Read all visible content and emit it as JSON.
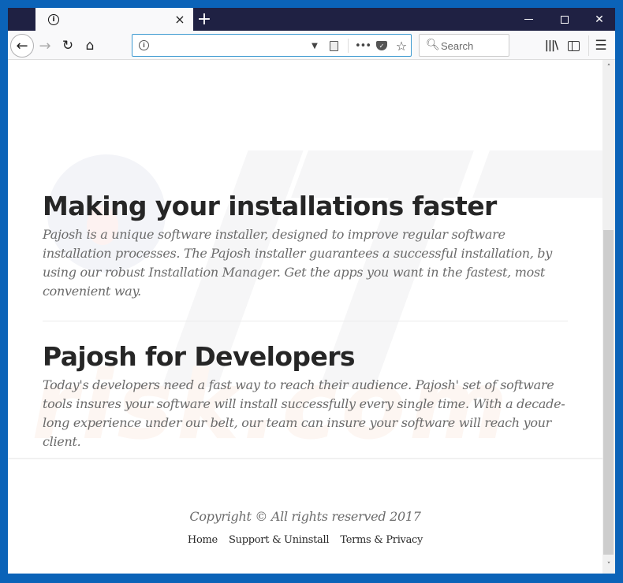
{
  "browser": {
    "tab": {
      "title": "",
      "close_glyph": "×"
    },
    "new_tab_glyph": "+",
    "window_controls": {
      "close_glyph": "✕"
    },
    "nav": {
      "back_glyph": "←",
      "forward_glyph": "→",
      "reload_glyph": "↻",
      "home_glyph": "⌂"
    },
    "urlbar": {
      "value": "",
      "placeholder": ""
    },
    "search": {
      "placeholder": "Search",
      "icon_glyph": "⚲"
    },
    "toolbar": {
      "more_glyph": "•••",
      "star_glyph": "☆",
      "library_glyph": "|||\\",
      "menu_glyph": "☰"
    },
    "scrollbar": {
      "up_glyph": "˄",
      "down_glyph": "˅",
      "scroll_fraction": 0.65
    }
  },
  "page": {
    "sections": [
      {
        "heading": "Making your installations faster",
        "body": "Pajosh is a unique software installer, designed to improve regular software installation processes. The Pajosh installer guarantees a successful installation, by using our robust Installation Manager. Get the apps you want in the fastest, most convenient way."
      },
      {
        "heading": "Pajosh for Developers",
        "body": "Today's developers need a fast way to reach their audience. Pajosh' set of software tools insures your software will install successfully every single time. With a decade-long experience under our belt, our team can insure your software will reach your client."
      }
    ],
    "footer": {
      "copyright": "Copyright © All rights reserved 2017",
      "links": [
        "Home",
        "Support & Uninstall",
        "Terms & Privacy"
      ]
    },
    "watermark_text": "risk.com"
  }
}
